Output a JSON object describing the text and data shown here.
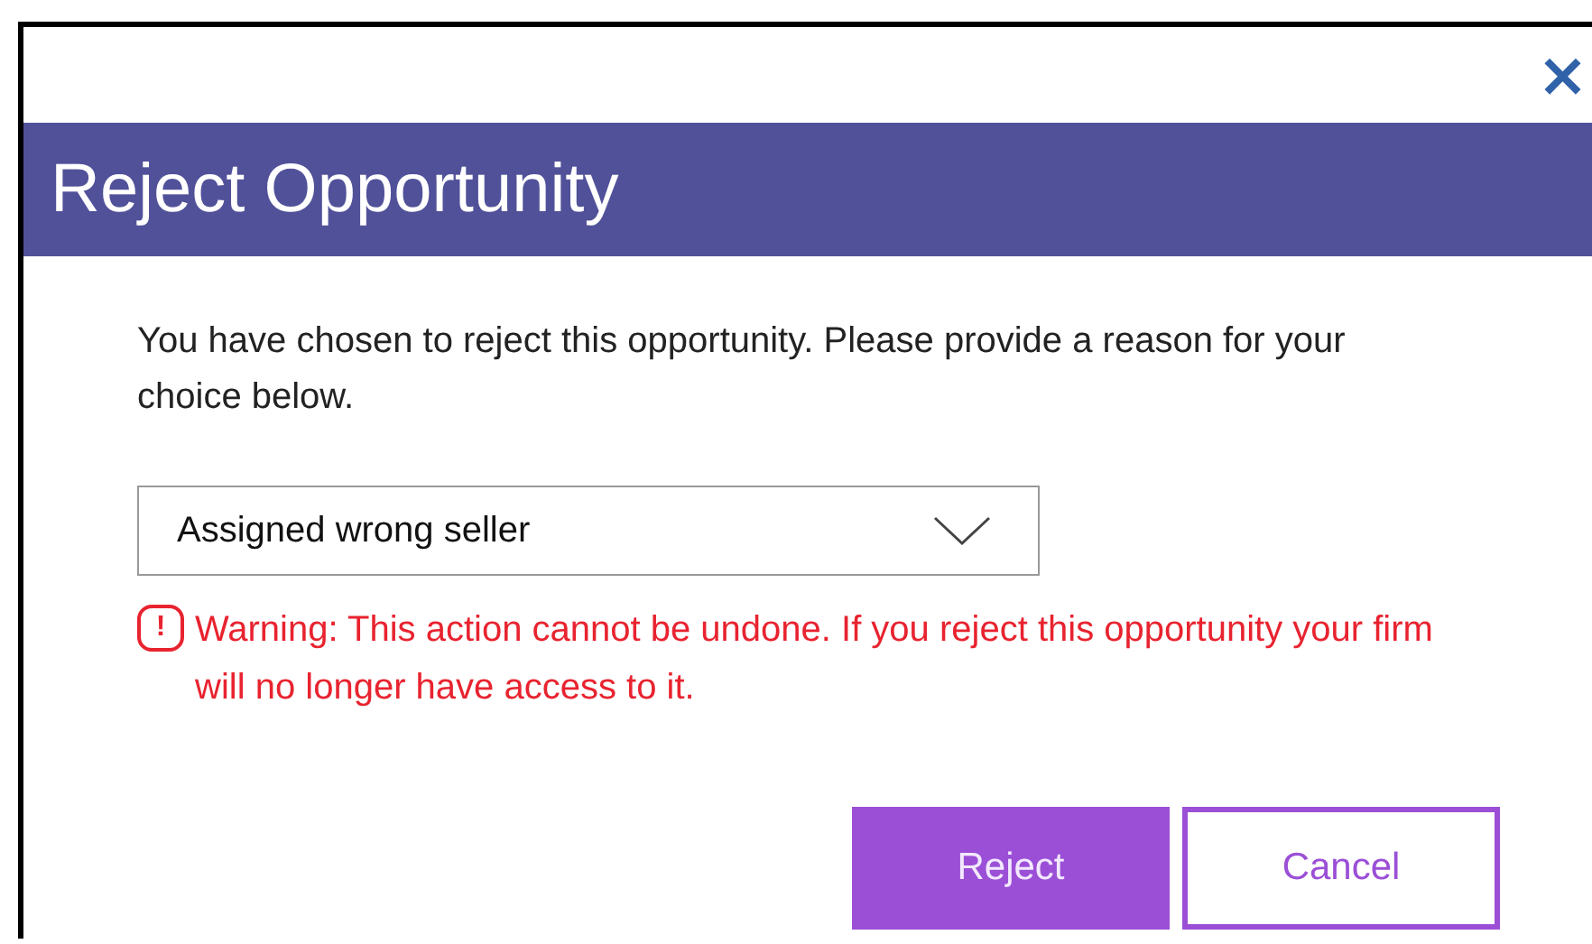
{
  "dialog": {
    "close": "×",
    "title": "Reject Opportunity",
    "message": "You have chosen to reject this opportunity. Please provide a reason for your choice below.",
    "reason": {
      "value": "Assigned wrong seller"
    },
    "warning": {
      "icon": "!",
      "text": "Warning: This action cannot be undone. If you reject this opportunity your firm will no longer have access to it."
    },
    "buttons": [
      {
        "label": "Reject",
        "kind": "primary"
      },
      {
        "label": "Cancel",
        "kind": "secondary"
      }
    ]
  }
}
